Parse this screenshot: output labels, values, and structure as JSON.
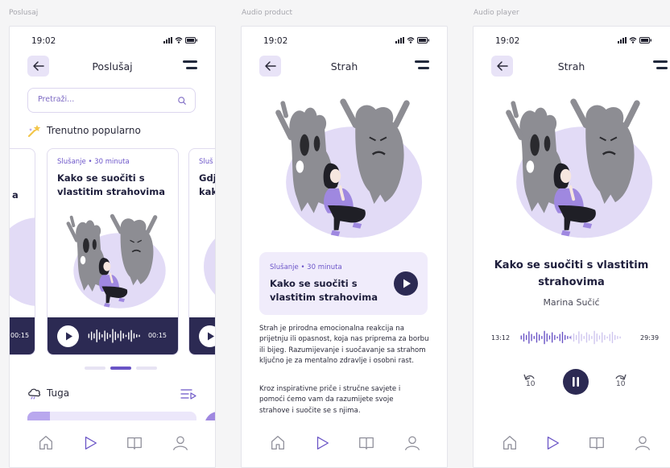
{
  "frames": [
    {
      "label": "Poslusaj"
    },
    {
      "label": "Audio product"
    },
    {
      "label": "Audio player"
    }
  ],
  "status_bar": {
    "time": "19:02"
  },
  "colors": {
    "accent": "#6a54c6",
    "dark": "#2c2a53",
    "lavender": "#e8e3f7",
    "blob": "#e2dbf6"
  },
  "screen1": {
    "title": "Poslušaj",
    "search_placeholder": "Pretraži...",
    "section_popular": "Trenutno popularno",
    "left_card_fragment": "a",
    "left_card_time": "00:15",
    "card": {
      "meta": "Slušanje • 30 minuta",
      "title": "Kako se suočiti s vlastitim strahovima",
      "time": "00:15"
    },
    "right_card": {
      "meta_fragment": "Sluš",
      "title_fragment_1": "Gdj",
      "title_fragment_2": "kak"
    },
    "carousel_active_index": 1,
    "section_sad": "Tuga"
  },
  "screen2": {
    "title": "Strah",
    "card": {
      "meta": "Slušanje • 30 minuta",
      "title": "Kako se suočiti s vlastitim strahovima"
    },
    "paragraph_1": "Strah je prirodna emocionalna reakcija na prijetnju ili opasnost, koja nas priprema za borbu ili bijeg. Razumijevanje i suočavanje sa strahom ključno je za mentalno zdravlje i osobni rast.",
    "paragraph_2": "Kroz inspirativne priče i stručne savjete i pomoći ćemo vam da razumijete svoje strahove i suočite se s njima."
  },
  "screen3": {
    "title": "Strah",
    "track_title": "Kako se suočiti s vlastitim strahovima",
    "author": "Marina Sučić",
    "elapsed": "13:12",
    "total": "29:39",
    "skip_back_label": "10",
    "skip_forward_label": "10"
  },
  "icons": {
    "back": "arrow-left-icon",
    "menu": "menu-icon",
    "search": "search-icon",
    "popular": "stars-icon",
    "sad": "cloud-icon",
    "playlist": "playlist-icon",
    "home": "home-icon",
    "play": "play-icon",
    "book": "book-icon",
    "profile": "user-icon"
  }
}
